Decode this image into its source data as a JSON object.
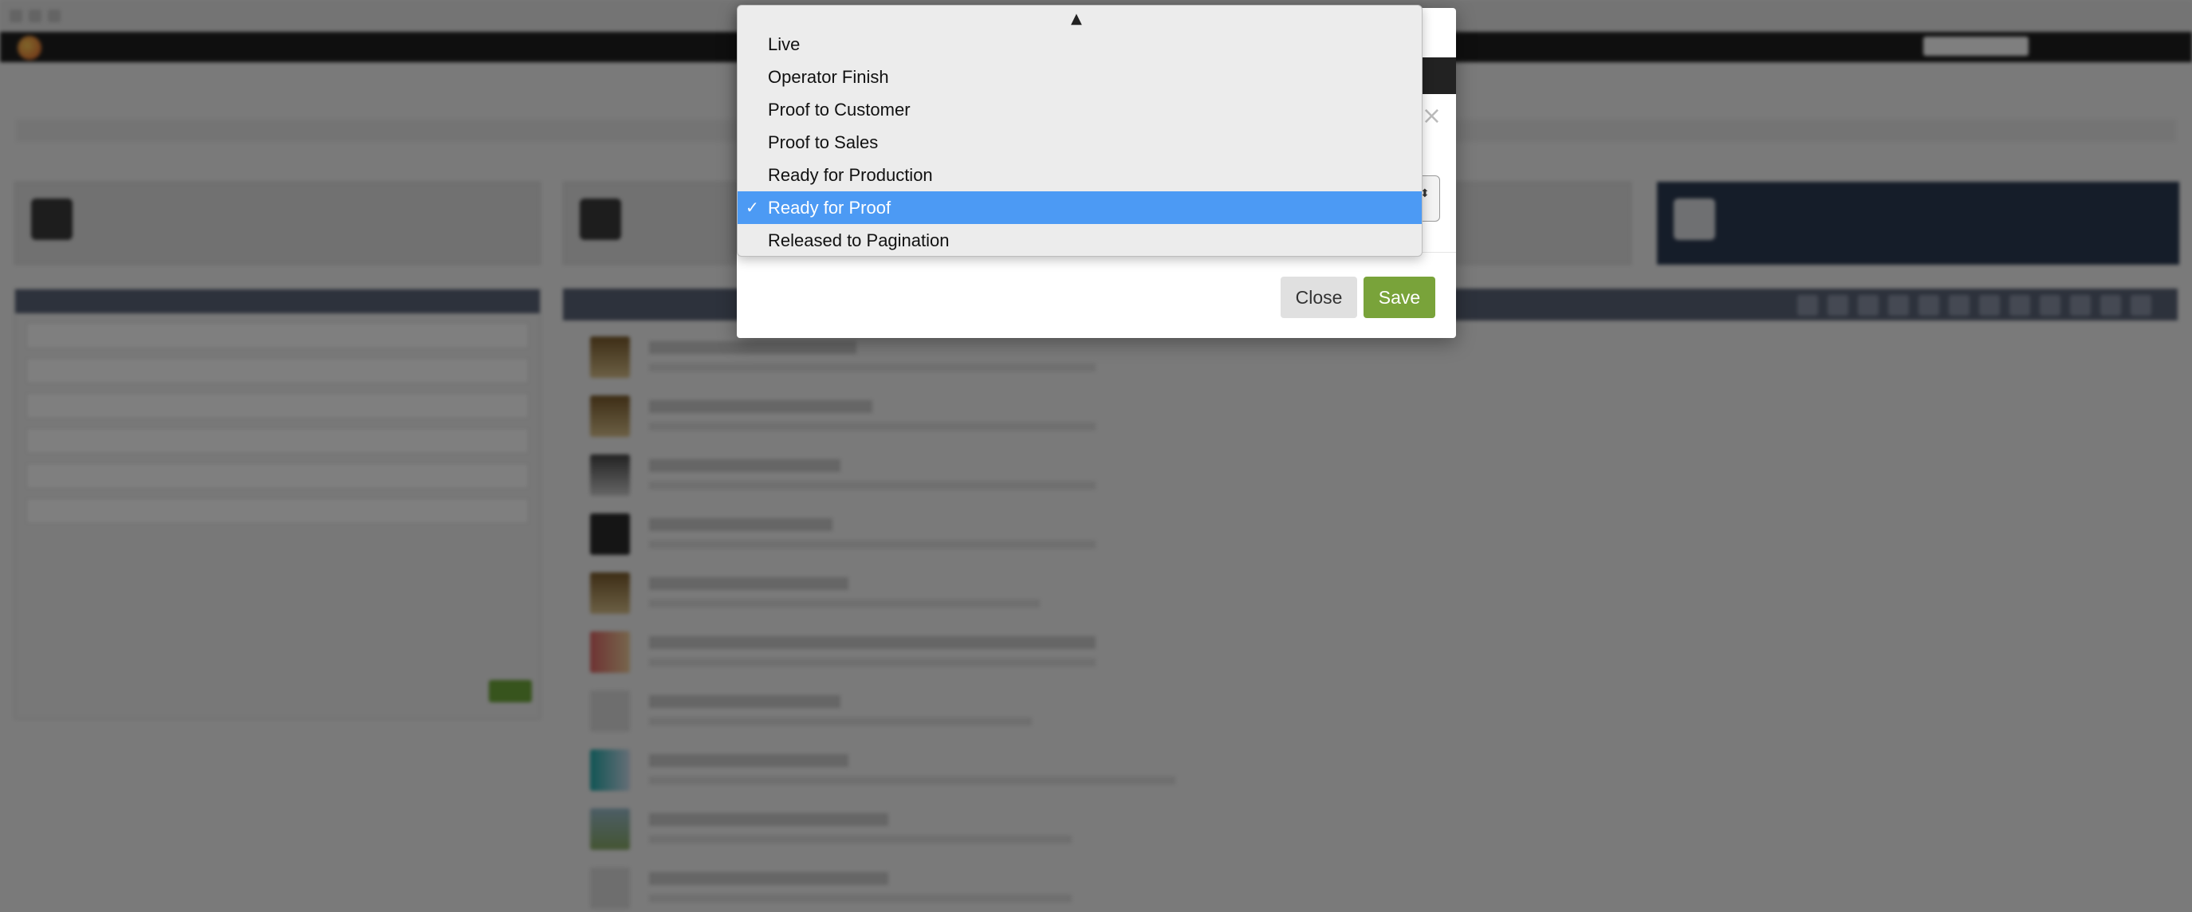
{
  "dropdown": {
    "options": [
      {
        "label": "Live"
      },
      {
        "label": "Operator Finish"
      },
      {
        "label": "Proof to Customer"
      },
      {
        "label": "Proof to Sales"
      },
      {
        "label": "Ready for Production"
      },
      {
        "label": "Ready for Proof",
        "selected": true
      },
      {
        "label": "Released to Pagination"
      }
    ],
    "selected_value": "Ready for Proof",
    "scroll_up_icon": "triangle-up-icon",
    "check_icon": "checkmark-icon"
  },
  "modal": {
    "close_icon": "close-icon",
    "buttons": {
      "close_label": "Close",
      "save_label": "Save"
    }
  },
  "colors": {
    "selected_option": "#4c9af4",
    "save_button": "#79a33a",
    "close_button": "#e0e0e0",
    "overlay": "rgba(0,0,0,0.5)",
    "status_badge": "#d8442c"
  }
}
